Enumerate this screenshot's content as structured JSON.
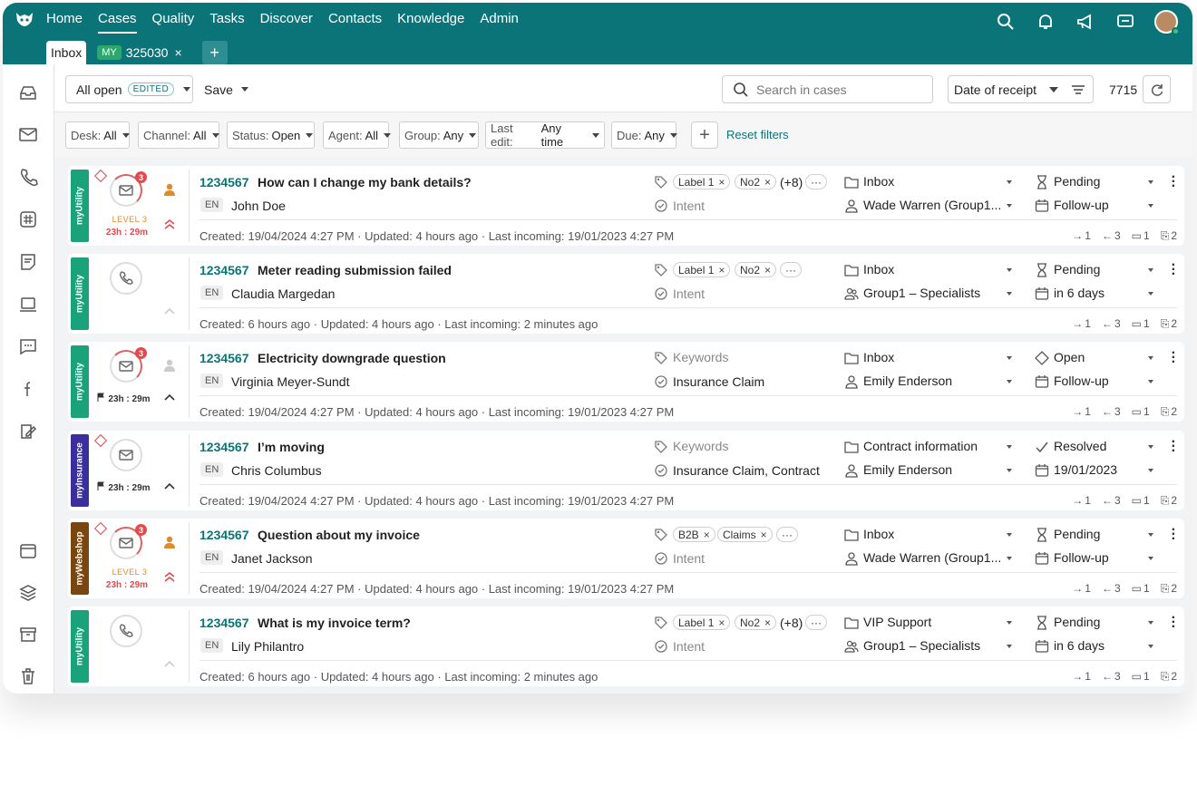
{
  "nav": {
    "items": [
      "Home",
      "Cases",
      "Quality",
      "Tasks",
      "Discover",
      "Contacts",
      "Knowledge",
      "Admin"
    ]
  },
  "tabs": {
    "inbox": "Inbox",
    "my_badge": "MY",
    "case_tab": "325030",
    "close": "×",
    "add": "+"
  },
  "toolbar": {
    "view": "All open",
    "edited": "EDITED",
    "save": "Save",
    "search_placeholder": "Search in cases",
    "sort": "Date of receipt",
    "count": "7715"
  },
  "filters": [
    {
      "label": "Desk:",
      "value": "All"
    },
    {
      "label": "Channel:",
      "value": "All"
    },
    {
      "label": "Status:",
      "value": "Open"
    },
    {
      "label": "Agent:",
      "value": "All"
    },
    {
      "label": "Group:",
      "value": "Any"
    },
    {
      "label": "Last edit:",
      "value": "Any time"
    },
    {
      "label": "Due:",
      "value": "Any"
    }
  ],
  "reset": "Reset filters",
  "cases": [
    {
      "brand": "myUtility",
      "brand_color": "#1aa37a",
      "channel": "mail",
      "badge": "3",
      "level": "LEVEL 3",
      "sla": "23h : 29m",
      "id": "1234567",
      "subject": "How can I change my bank details?",
      "lang": "EN",
      "customer": "John Doe",
      "tags": [
        "Label 1",
        "No2"
      ],
      "more": "(+8)",
      "intent": "Intent",
      "intent_muted": true,
      "folder": "Inbox",
      "assignee": "Wade Warren (Group1...",
      "status": "Pending",
      "due": "Follow-up",
      "meta": "Created: 19/04/2024 4:27 PM · Updated: 4 hours ago · Last incoming: 19/01/2023 4:27 PM",
      "out": "1",
      "in": "3",
      "notes": "1",
      "att": "2"
    },
    {
      "brand": "myUtility",
      "brand_color": "#1aa37a",
      "channel": "phone",
      "id": "1234567",
      "subject": "Meter reading submission failed",
      "lang": "EN",
      "customer": "Claudia Margedan",
      "tags": [
        "Label 1",
        "No2"
      ],
      "intent": "Intent",
      "intent_muted": true,
      "folder": "Inbox",
      "assignee": "Group1 – Specialists",
      "status": "Pending",
      "due": "in 6 days",
      "meta": "Created: 6 hours ago · Updated: 4 hours ago · Last incoming: 2 minutes ago",
      "out": "1",
      "in": "3",
      "notes": "1",
      "att": "2"
    },
    {
      "brand": "myUtility",
      "brand_color": "#1aa37a",
      "channel": "mail",
      "badge": "3",
      "sla": "23h : 29m",
      "id": "1234567",
      "subject": "Electricity downgrade question",
      "lang": "EN",
      "customer": "Virginia Meyer-Sundt",
      "keywords": "Keywords",
      "intent": "Insurance Claim",
      "folder": "Inbox",
      "assignee": "Emily Enderson",
      "status": "Open",
      "due": "Follow-up",
      "meta": "Created: 19/04/2024 4:27 PM · Updated: 4 hours ago · Last incoming: 19/01/2023 4:27 PM",
      "out": "1",
      "in": "3",
      "notes": "1",
      "att": "2"
    },
    {
      "brand": "myInsurance",
      "brand_color": "#3a2f9e",
      "channel": "mail",
      "sla": "23h : 29m",
      "id": "1234567",
      "subject": "I’m moving",
      "lang": "EN",
      "customer": "Chris Columbus",
      "keywords": "Keywords",
      "intent": "Insurance Claim, Contract",
      "folder": "Contract information",
      "assignee": "Emily Enderson",
      "status": "Resolved",
      "due": "19/01/2023",
      "meta": "Created: 19/04/2024 4:27 PM · Updated: 4 hours ago · Last incoming: 19/01/2023 4:27 PM",
      "out": "1",
      "in": "3",
      "notes": "1",
      "att": "2"
    },
    {
      "brand": "myWebshop",
      "brand_color": "#7a4610",
      "channel": "mail",
      "badge": "3",
      "level": "LEVEL 3",
      "sla": "23h : 29m",
      "id": "1234567",
      "subject": "Question about my invoice",
      "lang": "EN",
      "customer": "Janet Jackson",
      "tags": [
        "B2B",
        "Claims"
      ],
      "intent": "Intent",
      "intent_muted": true,
      "folder": "Inbox",
      "assignee": "Wade Warren (Group1...",
      "status": "Pending",
      "due": "Follow-up",
      "meta": "Created: 19/04/2024 4:27 PM · Updated: 4 hours ago · Last incoming: 19/01/2023 4:27 PM",
      "out": "1",
      "in": "3",
      "notes": "1",
      "att": "2"
    },
    {
      "brand": "myUtility",
      "brand_color": "#1aa37a",
      "channel": "phone",
      "id": "1234567",
      "subject": "What is my invoice term?",
      "lang": "EN",
      "customer": "Lily Philantro",
      "tags": [
        "Label 1",
        "No2"
      ],
      "more": "(+8)",
      "intent": "Intent",
      "intent_muted": true,
      "folder": "VIP Support",
      "assignee": "Group1 – Specialists",
      "status": "Pending",
      "due": "in 6 days",
      "meta": "Created: 6 hours ago · Updated: 4 hours ago · Last incoming: 2 minutes ago",
      "out": "1",
      "in": "3",
      "notes": "1",
      "att": "2"
    }
  ]
}
